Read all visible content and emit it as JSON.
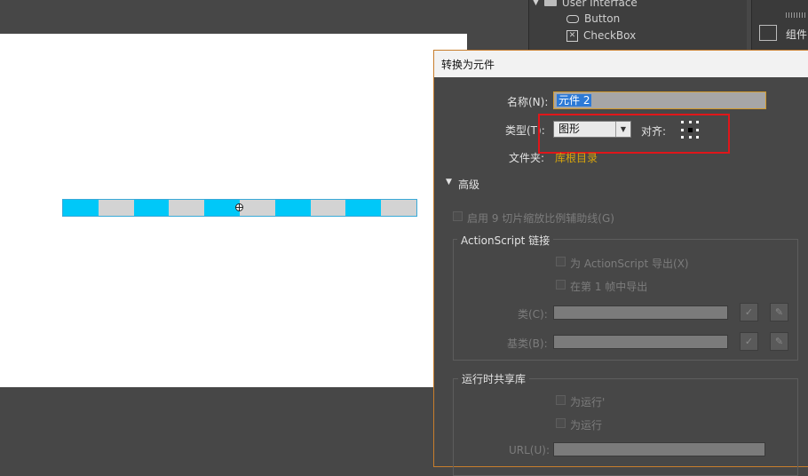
{
  "stage": {
    "strip_colors": [
      "#00c8f8",
      "#d3d3d3"
    ],
    "segment_count": 10
  },
  "library": {
    "folder_label": "User Interface",
    "items": [
      {
        "label": "Button",
        "icon": "button-icon"
      },
      {
        "label": "CheckBox",
        "icon": "checkbox-icon"
      }
    ]
  },
  "components_panel": {
    "label": "组件"
  },
  "dialog": {
    "title": "转换为元件",
    "name_label": "名称(N):",
    "name_value": "元件 2",
    "type_label": "类型(T):",
    "type_value": "图形",
    "align_label": "对齐:",
    "folder_label": "文件夹:",
    "folder_value": "库根目录",
    "advanced_label": "高级",
    "nine_slice_label": "启用 9 切片缩放比例辅助线(G)",
    "actionscript": {
      "legend": "ActionScript 链接",
      "export_for_as": "为 ActionScript 导出(X)",
      "export_frame1": "在第 1 帧中导出",
      "class_label": "类(C):",
      "base_class_label": "基类(B):"
    },
    "runtime": {
      "legend": "运行时共享库",
      "export_runtime": "为运行'",
      "import_runtime": "为运行",
      "url_label": "URL(U):"
    },
    "colors": {
      "accent": "#c87d2c",
      "highlight": "#e0161a",
      "folder_link": "#d9a60b"
    }
  }
}
